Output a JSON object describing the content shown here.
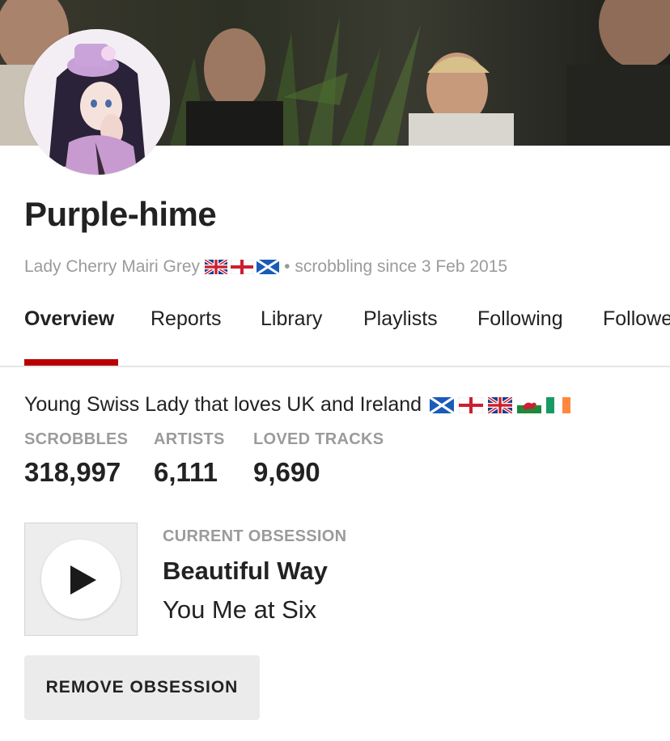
{
  "profile": {
    "name": "Purple-hime",
    "real_name": "Lady Cherry Mairi Grey",
    "meta_flags": [
      "united-kingdom-flag",
      "england-flag",
      "scotland-flag"
    ],
    "separator": "•",
    "scrobbling_since": "scrobbling since 3 Feb 2015"
  },
  "nav": {
    "tabs": [
      {
        "label": "Overview",
        "active": true
      },
      {
        "label": "Reports"
      },
      {
        "label": "Library"
      },
      {
        "label": "Playlists"
      },
      {
        "label": "Following"
      },
      {
        "label": "Followers"
      }
    ],
    "accent_color": "#b90000"
  },
  "bio": {
    "text": "Young Swiss Lady that loves UK and Ireland",
    "flags": [
      "scotland-flag",
      "england-flag",
      "united-kingdom-flag",
      "wales-flag",
      "ireland-flag"
    ]
  },
  "stats": [
    {
      "label": "SCROBBLES",
      "value": "318,997"
    },
    {
      "label": "ARTISTS",
      "value": "6,111"
    },
    {
      "label": "LOVED TRACKS",
      "value": "9,690"
    }
  ],
  "obsession": {
    "label": "CURRENT OBSESSION",
    "track": "Beautiful Way",
    "artist": "You Me at Six",
    "remove_label": "REMOVE OBSESSION"
  },
  "colors": {
    "text": "#222222",
    "muted": "#9b9b9b",
    "accent": "#b90000",
    "button_bg": "#ebebeb"
  }
}
